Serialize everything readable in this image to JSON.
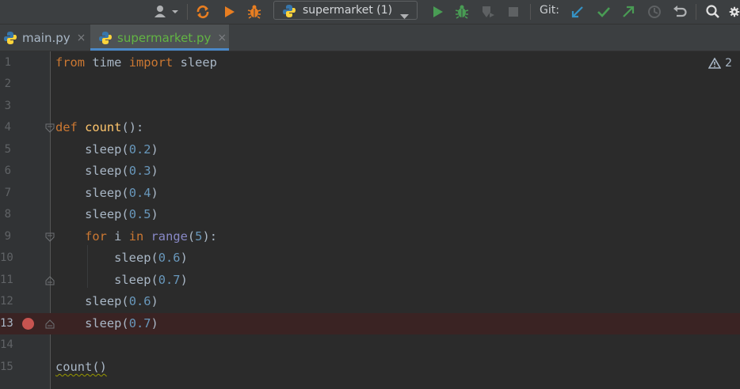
{
  "toolbar": {
    "run_config": "supermarket (1)",
    "git_label": "Git:"
  },
  "tabs": [
    {
      "label": "main.py",
      "close": "×",
      "active": false
    },
    {
      "label": "supermarket.py",
      "close": "×",
      "active": true
    }
  ],
  "editor": {
    "warning_count": "2",
    "lines": [
      {
        "n": "1"
      },
      {
        "n": "2"
      },
      {
        "n": "3"
      },
      {
        "n": "4"
      },
      {
        "n": "5"
      },
      {
        "n": "6"
      },
      {
        "n": "7"
      },
      {
        "n": "8"
      },
      {
        "n": "9"
      },
      {
        "n": "10"
      },
      {
        "n": "11"
      },
      {
        "n": "12"
      },
      {
        "n": "13"
      },
      {
        "n": "14"
      },
      {
        "n": "15"
      }
    ],
    "code": {
      "l1": {
        "kw1": "from",
        "mod": " time ",
        "kw2": "import",
        "name": " sleep"
      },
      "l4": {
        "kw": "def",
        "fn": "count",
        "rest": "():"
      },
      "l5": {
        "call": "sleep(",
        "num": "0.2",
        "close": ")"
      },
      "l6": {
        "call": "sleep(",
        "num": "0.3",
        "close": ")"
      },
      "l7": {
        "call": "sleep(",
        "num": "0.4",
        "close": ")"
      },
      "l8": {
        "call": "sleep(",
        "num": "0.5",
        "close": ")"
      },
      "l9": {
        "kw1": "for",
        "var": " i ",
        "kw2": "in",
        "sp": " ",
        "bi": "range",
        "open": "(",
        "num": "5",
        "close": "):"
      },
      "l10": {
        "call": "sleep(",
        "num": "0.6",
        "close": ")"
      },
      "l11": {
        "call": "sleep(",
        "num": "0.7",
        "close": ")"
      },
      "l12": {
        "call": "sleep(",
        "num": "0.6",
        "close": ")"
      },
      "l13": {
        "call": "sleep(",
        "num": "0.7",
        "close": ")"
      },
      "l15": {
        "call": "count()"
      }
    }
  },
  "colors": {
    "background": "#2b2b2b",
    "keyword": "#cc7832",
    "function": "#ffc66d",
    "number": "#6897bb",
    "breakpoint": "#c75450",
    "run_green": "#499c54",
    "debug_orange": "#e87e21",
    "git_blue": "#3592c4"
  }
}
